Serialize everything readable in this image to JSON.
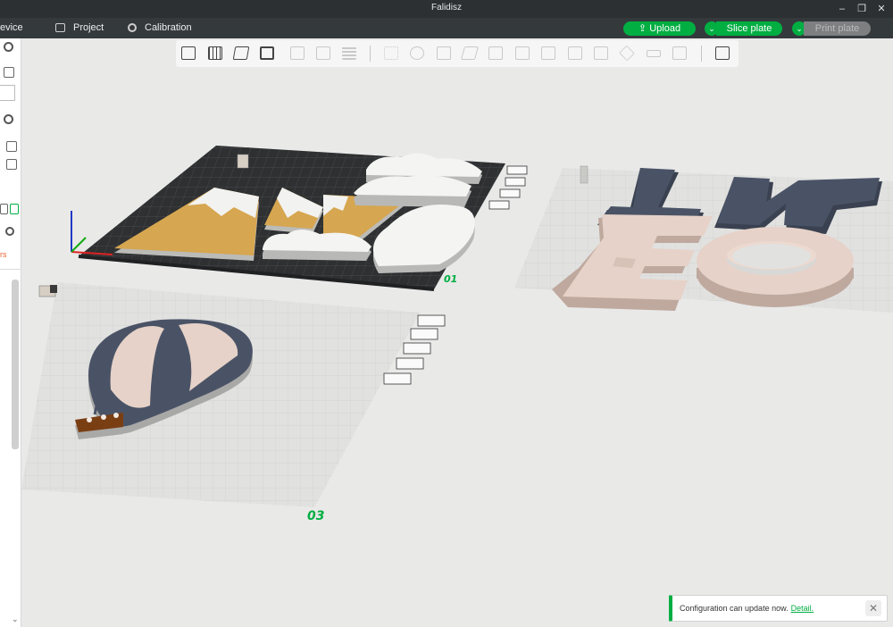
{
  "window": {
    "title": "Falidisz"
  },
  "menubar": {
    "device": "evice",
    "project": "Project",
    "calibration": "Calibration"
  },
  "actions": {
    "upload": "Upload",
    "slice": "Slice plate",
    "print": "Print plate"
  },
  "leftpanel": {
    "warn_text": "rs"
  },
  "toolbar": {
    "buttons": [
      "add-cube-icon",
      "add-plate-icon",
      "auto-orient-icon",
      "arrange-icon",
      "copy-icon",
      "paste-icon",
      "layers-icon",
      "move-icon",
      "rotate-icon",
      "scale-icon",
      "lay-on-face-icon",
      "cut-icon",
      "split-objects-icon",
      "split-parts-icon",
      "boolean-icon",
      "text-icon",
      "paint-icon",
      "measure-icon",
      "assembly-icon",
      "view-icon"
    ]
  },
  "plates": {
    "p1": "01",
    "p3": "03"
  },
  "colors": {
    "accent": "#00ae42",
    "plate_dark": "#2e3032",
    "plate_light": "#e4e4e3",
    "slate": "#4a5366",
    "pink": "#e6d2c8",
    "gold": "#d6a650",
    "brown": "#7a3e13"
  },
  "toast": {
    "message": "Configuration can update now.",
    "link": "Detail."
  }
}
